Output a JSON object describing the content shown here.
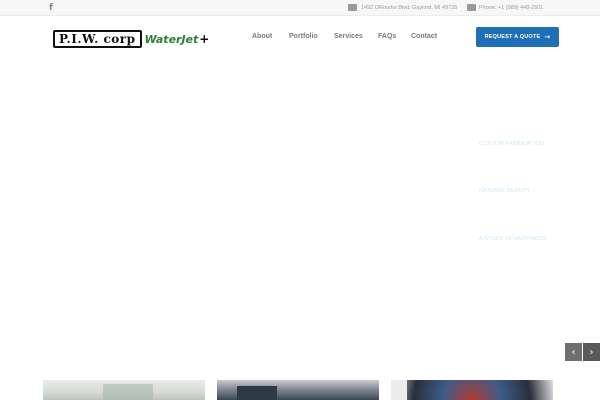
{
  "topbar": {
    "social_icon": "facebook-icon",
    "address": "1492 ORourke Blvd, Gaylord, MI 49735",
    "phone": "Phone: +1 (989) 448-2501"
  },
  "logo": {
    "main": "P.I.W. corp",
    "sub": "WaterJet",
    "plus": "+"
  },
  "nav": {
    "items": [
      "About",
      "Portfolio",
      "Services",
      "FAQs",
      "Contact"
    ]
  },
  "cta": {
    "label": "REQUEST A QUOTE",
    "arrow": "→"
  },
  "hero": {
    "items": [
      "CUSTOM FABRICATION",
      "NATURAL BEAUTY",
      "A STUDY IN HAPPINESS"
    ]
  },
  "slider": {
    "prev": "‹",
    "next": "›"
  },
  "colors": {
    "accent": "#1e6fb5",
    "logo_green": "#2e7f3a"
  }
}
